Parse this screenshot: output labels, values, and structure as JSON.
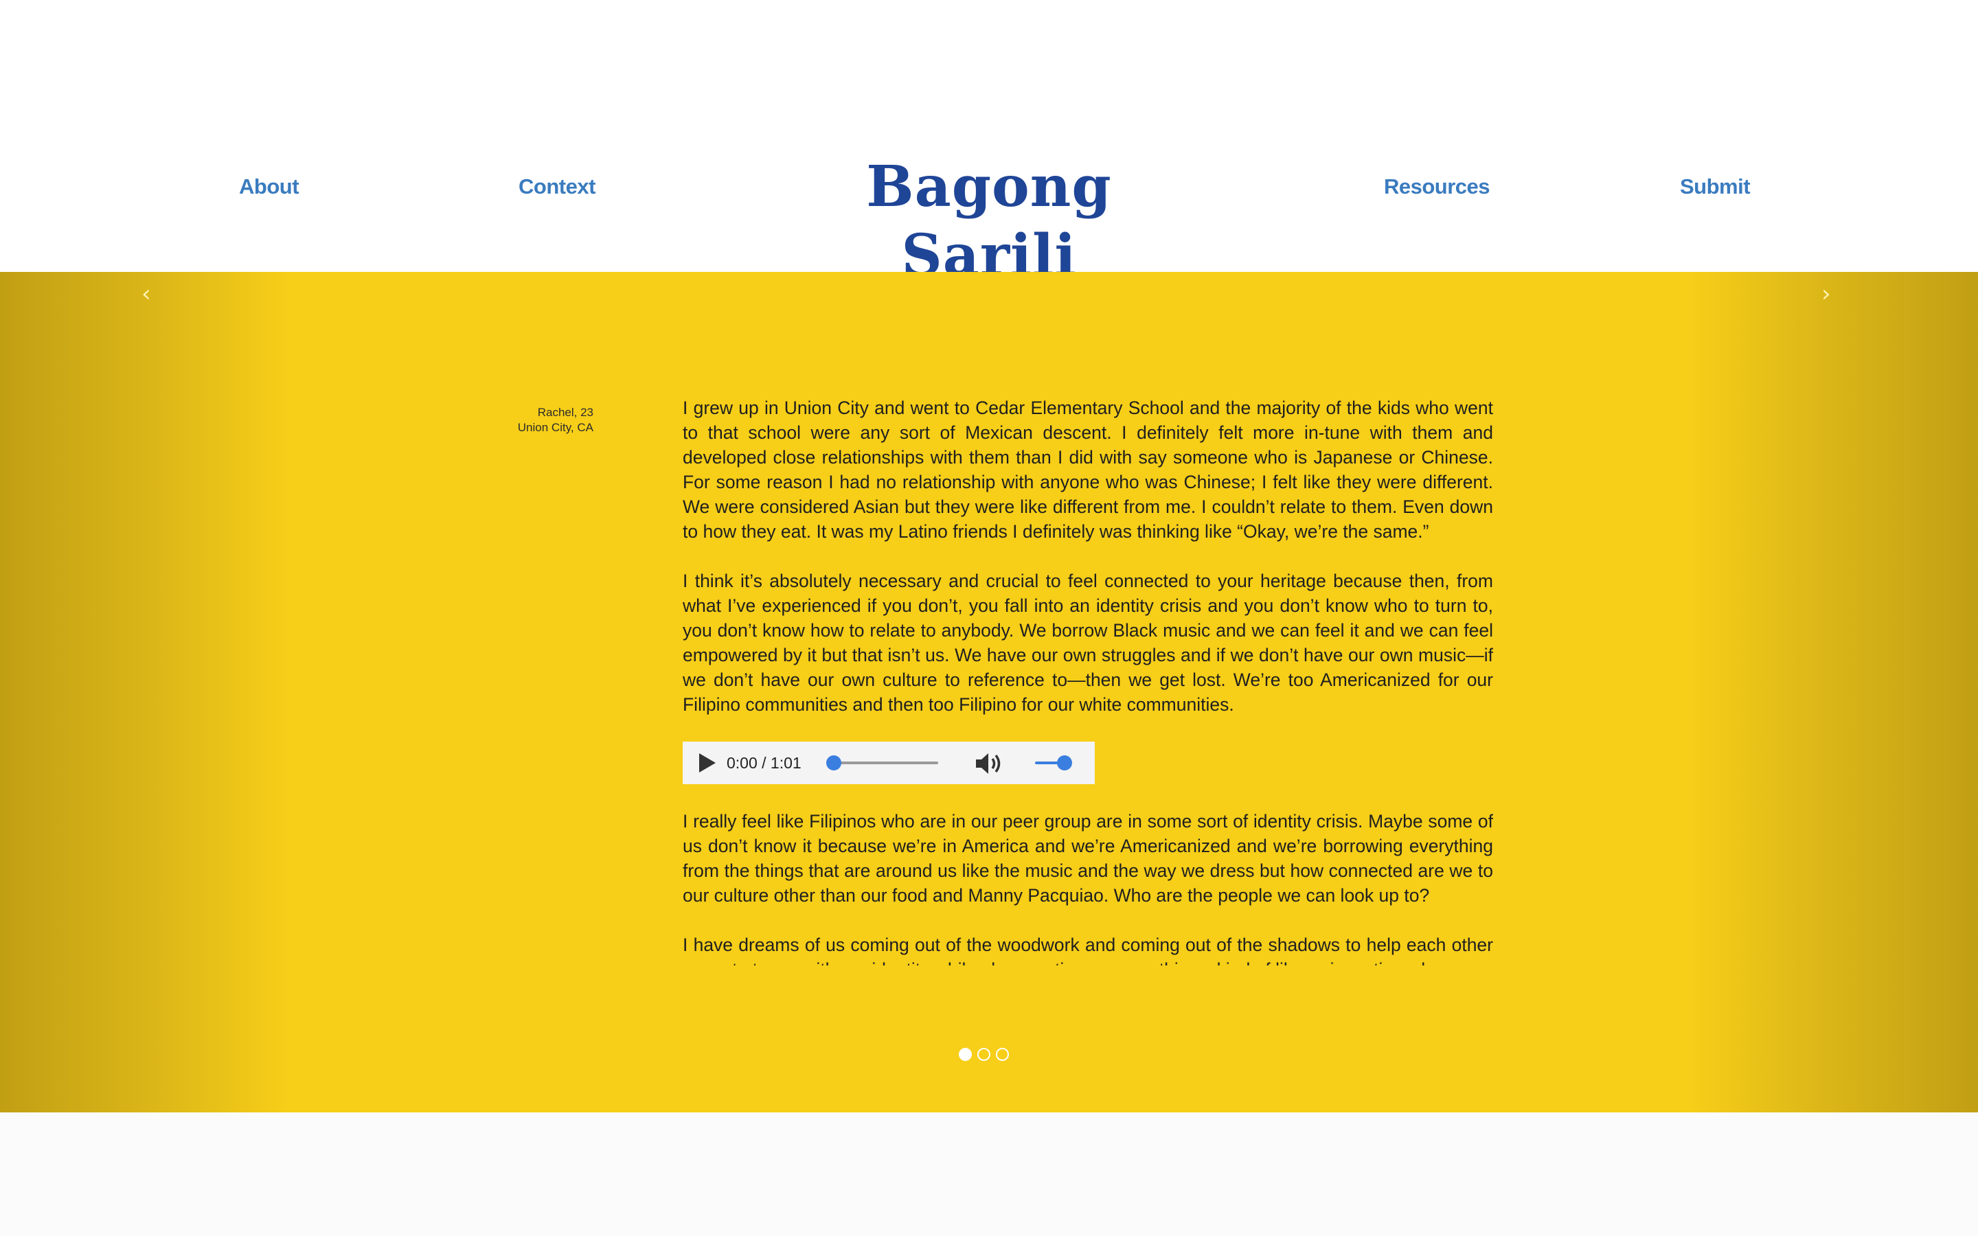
{
  "header": {
    "title": "Bagong Sarili",
    "nav": {
      "about": "About",
      "context": "Context",
      "resources": "Resources",
      "submit": "Submit"
    }
  },
  "carousel": {
    "prev_glyph": "‹",
    "next_glyph": "›",
    "credit": {
      "name": "Rachel, 23",
      "location": "Union City, CA"
    },
    "paragraphs": [
      "I grew up in Union City and went to Cedar Elementary School and the majority of the kids who went to that school were any sort of Mexican descent. I definitely felt more in-tune with them and developed close relationships with them than I did with say someone who is Japanese or Chinese. For some reason I had no relationship with anyone who was Chinese; I felt like they were different. We were considered Asian but they were like different from me. I couldn’t relate to them. Even down to how they eat. It was my Latino friends I definitely was thinking like “Okay, we’re the same.”",
      "I think it’s absolutely necessary and crucial to feel connected to your heritage because then, from what I’ve experienced if you don’t, you fall into an identity crisis and you don’t know who to turn to, you don’t know how to relate to anybody. We borrow Black music and we can feel it and we can feel empowered by it but that isn’t us. We have our own struggles and if we don’t have our own music—if we don’t have our own culture to reference to—then we get lost. We’re too Americanized for our Filipino communities and then too Filipino for our white communities.",
      "I really feel like Filipinos who are in our peer group are in some sort of identity crisis. Maybe some of us don’t know it because we’re in America and we’re Americanized and we’re borrowing everything from the things that are around us like the music and the way we dress but how connected are we to our culture other than our food and Manny Pacquiao. Who are the people we can look up to?",
      "I have dreams of us coming out of the woodwork and coming out of the shadows to help each other come to terms with our identity while also creating our own thing—kind of like re-inventing who we"
    ],
    "audio": {
      "time": "0:00 / 1:01",
      "progress": 0,
      "volume": 1
    },
    "slides_total": 3,
    "active_slide": 1
  },
  "colors": {
    "nav": "#3a7bbf",
    "title": "#1f4597",
    "band": "#f7ce18",
    "player_accent": "#3a7ee0"
  },
  "icons": {
    "prev": "chevron-left-icon",
    "next": "chevron-right-icon",
    "play": "play-icon",
    "volume": "volume-icon"
  }
}
